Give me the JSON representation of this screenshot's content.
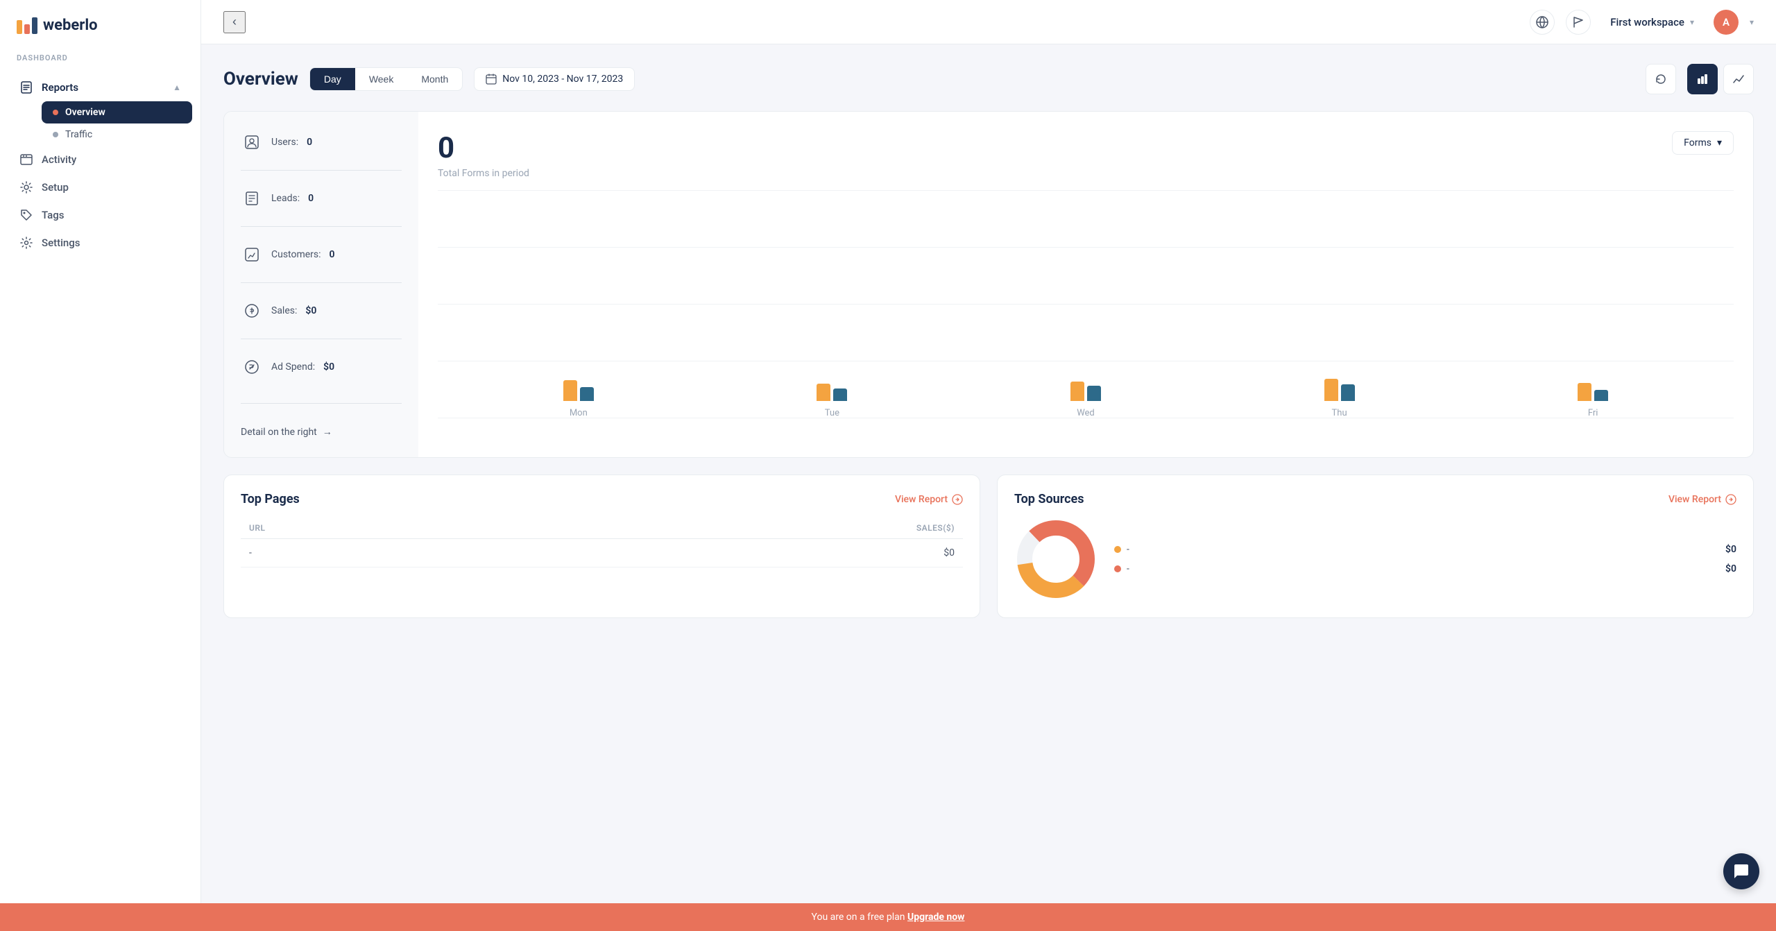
{
  "app": {
    "name": "weberlo"
  },
  "topbar": {
    "workspace": "First workspace",
    "avatar_letter": "A",
    "date_range": "Nov 10, 2023 - Nov 17, 2023"
  },
  "sidebar": {
    "section_label": "DASHBOARD",
    "nav_items": [
      {
        "id": "reports",
        "label": "Reports",
        "icon": "📋",
        "active": true,
        "expanded": true
      },
      {
        "id": "activity",
        "label": "Activity",
        "icon": "📊"
      },
      {
        "id": "setup",
        "label": "Setup",
        "icon": "⚙️"
      },
      {
        "id": "tags",
        "label": "Tags",
        "icon": "🏷️"
      },
      {
        "id": "settings",
        "label": "Settings",
        "icon": "⚙️"
      }
    ],
    "sub_items": [
      {
        "id": "overview",
        "label": "Overview",
        "active": true
      },
      {
        "id": "traffic",
        "label": "Traffic",
        "active": false
      }
    ]
  },
  "overview": {
    "title": "Overview",
    "period_tabs": [
      "Day",
      "Week",
      "Month"
    ],
    "active_tab": "Day",
    "date_range": "Nov 10, 2023 - Nov 17, 2023",
    "stats": {
      "users": {
        "label": "Users:",
        "value": "0"
      },
      "leads": {
        "label": "Leads:",
        "value": "0"
      },
      "customers": {
        "label": "Customers:",
        "value": "0"
      },
      "sales": {
        "label": "Sales:",
        "value": "$0"
      },
      "ad_spend": {
        "label": "Ad Spend:",
        "value": "$0"
      }
    },
    "detail_link": "Detail on the right",
    "chart": {
      "total": "0",
      "subtitle": "Total Forms in period",
      "dropdown": "Forms",
      "days": [
        "Mon",
        "Tue",
        "Wed",
        "Thu",
        "Fri"
      ]
    }
  },
  "top_pages": {
    "title": "Top Pages",
    "view_report_label": "View Report",
    "columns": [
      "URL",
      "Sales($)"
    ],
    "rows": [
      {
        "url": "-",
        "sales": "$0"
      }
    ]
  },
  "top_sources": {
    "title": "Top Sources",
    "view_report_label": "View Report",
    "legend": [
      {
        "label": "-",
        "value": "$0",
        "color": "#f4a340"
      },
      {
        "label": "-",
        "value": "$0",
        "color": "#e8725a"
      }
    ]
  },
  "banner": {
    "text": "You are on a free plan",
    "cta": "Upgrade now"
  },
  "icons": {
    "back": "‹",
    "globe": "🌐",
    "flag": "⚑",
    "chevron_down": "▾",
    "calendar": "📅",
    "refresh": "↺",
    "bar_chart": "▐",
    "line_chart": "⌇",
    "arrow_right": "→",
    "circle_arrow": "⊙"
  }
}
